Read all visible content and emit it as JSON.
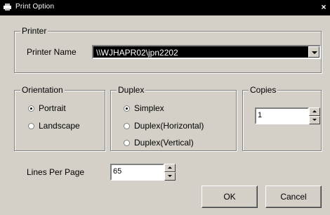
{
  "window": {
    "title": "Print Option",
    "close_glyph": "×"
  },
  "printer_group": {
    "legend": "Printer",
    "name_label": "Printer Name",
    "selected_printer": "\\\\WJHAPR02\\jpn2202"
  },
  "orientation_group": {
    "legend": "Orientation",
    "options": [
      {
        "label": "Portrait",
        "selected": true
      },
      {
        "label": "Landscape",
        "selected": false
      }
    ]
  },
  "duplex_group": {
    "legend": "Duplex",
    "options": [
      {
        "label": "Simplex",
        "selected": true
      },
      {
        "label": "Duplex(Horizontal)",
        "selected": false
      },
      {
        "label": "Duplex(Vertical)",
        "selected": false
      }
    ]
  },
  "copies_group": {
    "legend": "Copies",
    "value": "1"
  },
  "lines_per_page": {
    "label": "Lines Per Page",
    "value": "65"
  },
  "buttons": {
    "ok": "OK",
    "cancel": "Cancel"
  },
  "colors": {
    "face": "#d4d0c8",
    "title_bar": "#000000",
    "combo_selected": "#000000"
  },
  "icons": {
    "title": "printer-window-icon"
  }
}
